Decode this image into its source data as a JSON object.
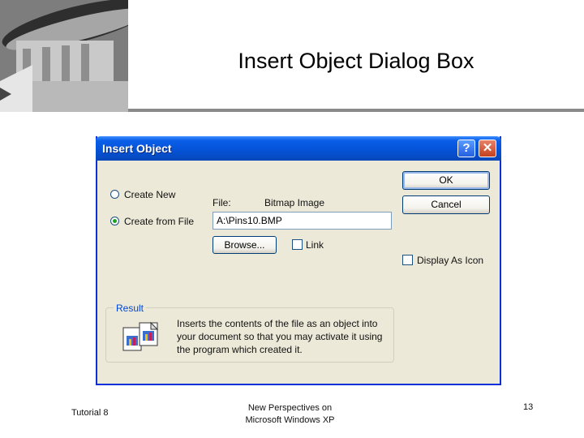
{
  "slide": {
    "title": "Insert Object Dialog Box",
    "footer_left": "Tutorial 8",
    "footer_center_line1": "New Perspectives on",
    "footer_center_line2": "Microsoft Windows XP",
    "page_number": "13"
  },
  "dialog": {
    "title": "Insert Object",
    "help_label": "?",
    "close_label": "✕",
    "ok_label": "OK",
    "cancel_label": "Cancel",
    "radio_create_new": "Create New",
    "radio_create_from_file": "Create from File",
    "selected_option": "Create from File",
    "file_label": "File:",
    "file_type": "Bitmap Image",
    "file_path": "A:\\Pins10.BMP",
    "browse_label": "Browse...",
    "link_label": "Link",
    "link_checked": false,
    "display_as_icon_label": "Display As Icon",
    "display_as_icon_checked": false,
    "result_group_label": "Result",
    "result_text": "Inserts the contents of the file as an object into your document so that you may activate it using the program which created it."
  },
  "colors": {
    "titlebar": "#0552d6",
    "dialog_face": "#ece9d8",
    "group_label": "#0046d5"
  }
}
